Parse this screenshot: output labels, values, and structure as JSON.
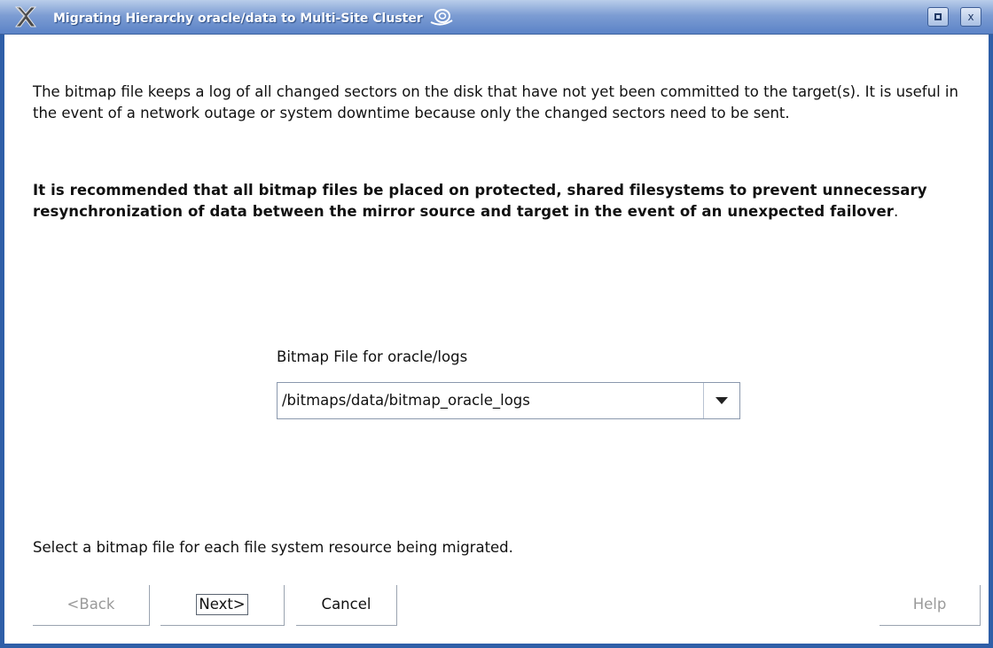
{
  "window": {
    "title": "Migrating Hierarchy oracle/data to Multi-Site Cluster",
    "app_icon": "x-icon",
    "controls": {
      "maximize_icon": "maximize-icon",
      "close_label": "x"
    },
    "colors": {
      "titlebar": "#5b83c7",
      "border": "#2f5fa8"
    }
  },
  "content": {
    "intro": "The bitmap file keeps a log of all changed sectors on the disk that have not yet been committed to the target(s). It is useful in the event of a network outage or system downtime because only the changed sectors need to be sent.",
    "recommendation": "It is recommended that all bitmap files be placed on protected, shared filesystems to prevent unnecessary resynchronization of data between the mirror source and target in the event of an unexpected failover",
    "recommendation_tail": ".",
    "field_label": "Bitmap File for oracle/logs",
    "field_value": "/bitmaps/data/bitmap_oracle_logs",
    "instruction": "Select a bitmap file for each file system resource being migrated."
  },
  "buttons": {
    "back": "<Back",
    "next": "Next>",
    "cancel": "Cancel",
    "help": "Help"
  }
}
